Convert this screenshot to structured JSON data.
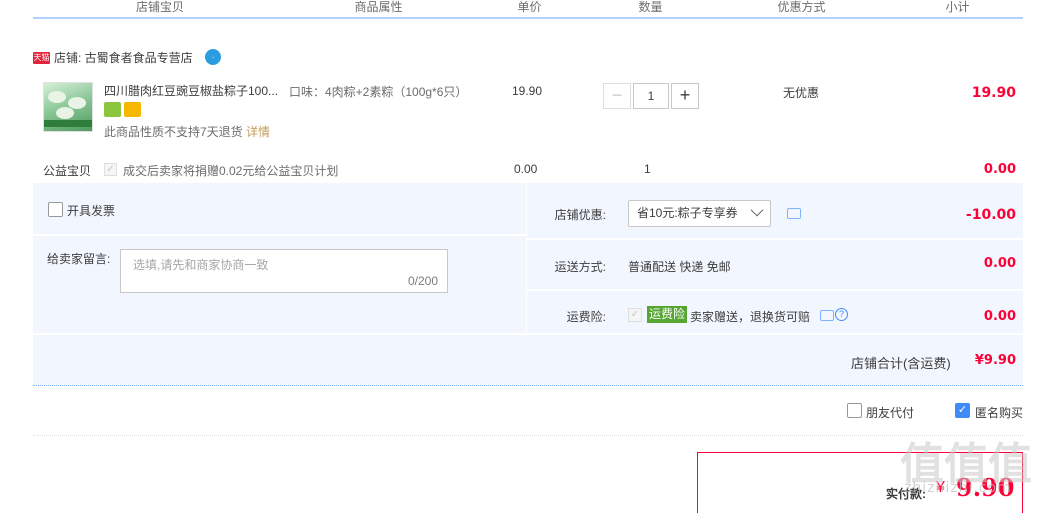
{
  "table_headers": [
    "店铺宝贝",
    "商品属性",
    "单价",
    "数量",
    "优惠方式",
    "小计"
  ],
  "shop": {
    "badge": "天猫",
    "label": "店铺: 古蜀食者食品专营店"
  },
  "item": {
    "title": "四川腊肉红豆豌豆椒盐粽子100...",
    "no_return_text": "此商品性质不支持7天退货",
    "detail_link": "详情",
    "sku": "口味：4肉粽+2素粽（100g*6只）",
    "price": "19.90",
    "quantity": "1",
    "promo": "无优惠",
    "subtotal": "19.90"
  },
  "charity": {
    "label": "公益宝贝",
    "text": "成交后卖家将捐赠0.02元给公益宝贝计划",
    "price": "0.00",
    "quantity": "1",
    "subtotal": "0.00"
  },
  "invoice_label": "开具发票",
  "message": {
    "label": "给卖家留言:",
    "placeholder": "选填,请先和商家协商一致",
    "counter": "0/200"
  },
  "shop_discount": {
    "label": "店铺优惠:",
    "selected": "省10元:粽子专享券",
    "value": "-10.00"
  },
  "shipping": {
    "label": "运送方式:",
    "value": "普通配送 快递 免邮",
    "fee": "0.00"
  },
  "insurance": {
    "label": "运费险:",
    "badge": "运费险",
    "text": "卖家赠送，退换货可赔",
    "fee": "0.00"
  },
  "shop_total": {
    "label": "店铺合计(含运费)",
    "value": "¥9.90"
  },
  "options": {
    "friend_pay": "朋友代付",
    "anonymous": "匿名购买"
  },
  "payment": {
    "label": "实付款:",
    "currency": "¥",
    "value": "9.90"
  },
  "watermark": {
    "glyphs": "值值值",
    "text": "zhizhizhi.com"
  },
  "colors": {
    "accent_red": "#ff0036",
    "panel_blue": "#f2f7ff",
    "check_blue": "#3d8cf7",
    "insurance_green": "#55a532"
  }
}
